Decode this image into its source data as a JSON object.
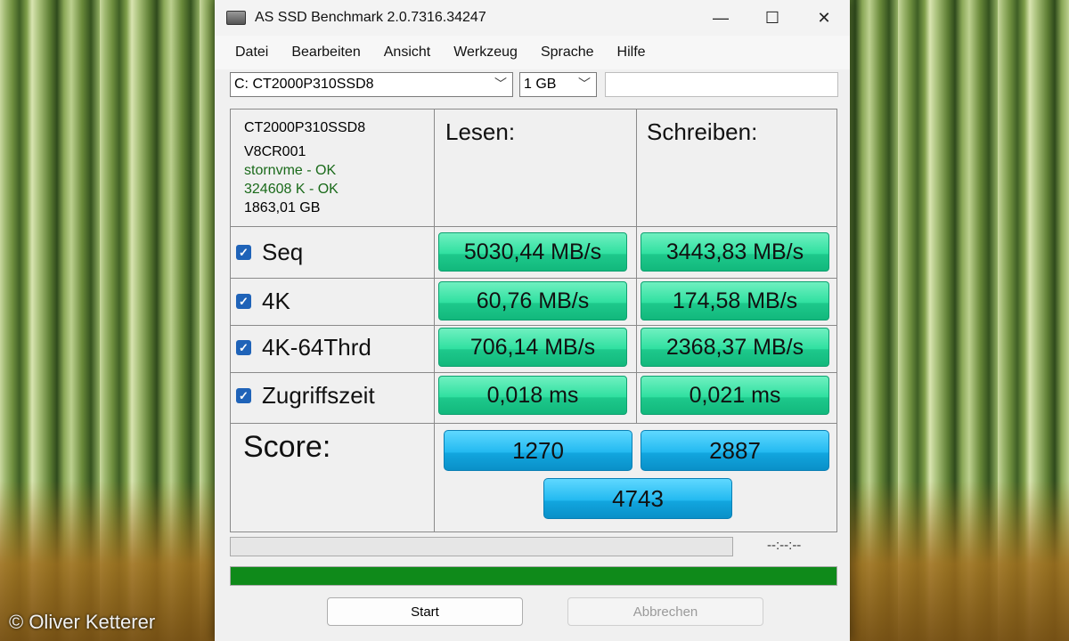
{
  "window": {
    "title": "AS SSD Benchmark 2.0.7316.34247",
    "minimize": "—",
    "maximize": "☐",
    "close": "✕"
  },
  "menu": [
    "Datei",
    "Bearbeiten",
    "Ansicht",
    "Werkzeug",
    "Sprache",
    "Hilfe"
  ],
  "toolbar": {
    "drive": "C: CT2000P310SSD8",
    "size": "1 GB",
    "text": ""
  },
  "drive_info": {
    "model": "CT2000P310SSD8",
    "firmware": "V8CR001",
    "driver": "stornvme - OK",
    "alignment": "324608 K - OK",
    "capacity": "1863,01 GB"
  },
  "headers": {
    "read": "Lesen:",
    "write": "Schreiben:"
  },
  "rows": [
    {
      "label": "Seq",
      "checked": true,
      "read": "5030,44 MB/s",
      "write": "3443,83 MB/s"
    },
    {
      "label": "4K",
      "checked": true,
      "read": "60,76 MB/s",
      "write": "174,58 MB/s"
    },
    {
      "label": "4K-64Thrd",
      "checked": true,
      "read": "706,14 MB/s",
      "write": "2368,37 MB/s"
    },
    {
      "label": "Zugriffszeit",
      "checked": true,
      "read": "0,018 ms",
      "write": "0,021 ms"
    }
  ],
  "score": {
    "label": "Score:",
    "read": "1270",
    "write": "2887",
    "total": "4743"
  },
  "progress": {
    "elapsed": "--:--:--",
    "total_fill": 1.0
  },
  "buttons": {
    "start": "Start",
    "cancel": "Abbrechen"
  },
  "watermark": "© Oliver Ketterer",
  "colors": {
    "result_green": "#2fe0a0",
    "score_blue": "#22b9f0",
    "progress_green": "#0f8a1a"
  }
}
